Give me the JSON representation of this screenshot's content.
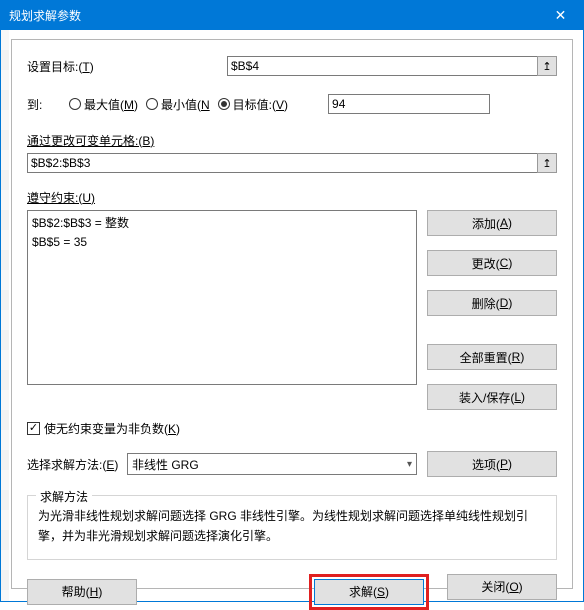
{
  "title": "规划求解参数",
  "labels": {
    "setObjective_pre": "设置目标:(",
    "setObjective_u": "T",
    "setObjective_post": ")",
    "to": "到:",
    "byChanging_pre": "通过更改可变单元格:(",
    "byChanging_u": "B",
    "byChanging_post": ")",
    "subjectTo_pre": "遵守约束:(",
    "subjectTo_u": "U",
    "subjectTo_post": ")",
    "nonneg_pre": "使无约束变量为非负数(",
    "nonneg_u": "K",
    "nonneg_post": ")",
    "method_pre": "选择求解方法:(",
    "method_u": "E",
    "method_post": ")",
    "groupTitle": "求解方法",
    "groupText": "为光滑非线性规划求解问题选择 GRG 非线性引擎。为线性规划求解问题选择单纯线性规划引擎，并为非光滑规划求解问题选择演化引擎。"
  },
  "radios": {
    "max_pre": "最大值(",
    "max_u": "M",
    "max_post": ")",
    "min_pre": "最小值(",
    "min_u": "N",
    "min_post": "",
    "val_pre": "目标值:(",
    "val_u": "V",
    "val_post": ")"
  },
  "inputs": {
    "objective": "$B$4",
    "targetValue": "94",
    "changingCells": "$B$2:$B$3",
    "method": "非线性 GRG"
  },
  "constraints": [
    "$B$2:$B$3 = 整数",
    "$B$5 = 35"
  ],
  "buttons": {
    "add_pre": "添加(",
    "add_u": "A",
    "add_post": ")",
    "change_pre": "更改(",
    "change_u": "C",
    "change_post": ")",
    "delete_pre": "删除(",
    "delete_u": "D",
    "delete_post": ")",
    "resetAll_pre": "全部重置(",
    "resetAll_u": "R",
    "resetAll_post": ")",
    "loadSave_pre": "装入/保存(",
    "loadSave_u": "L",
    "loadSave_post": ")",
    "options_pre": "选项(",
    "options_u": "P",
    "options_post": ")",
    "help_pre": "帮助(",
    "help_u": "H",
    "help_post": ")",
    "solve_pre": "求解(",
    "solve_u": "S",
    "solve_post": ")",
    "close_pre": "关闭(",
    "close_u": "O",
    "close_post": ")"
  },
  "checkmark": "✓",
  "arrowUp": "↥",
  "chevDown": "▾",
  "closeX": "✕"
}
